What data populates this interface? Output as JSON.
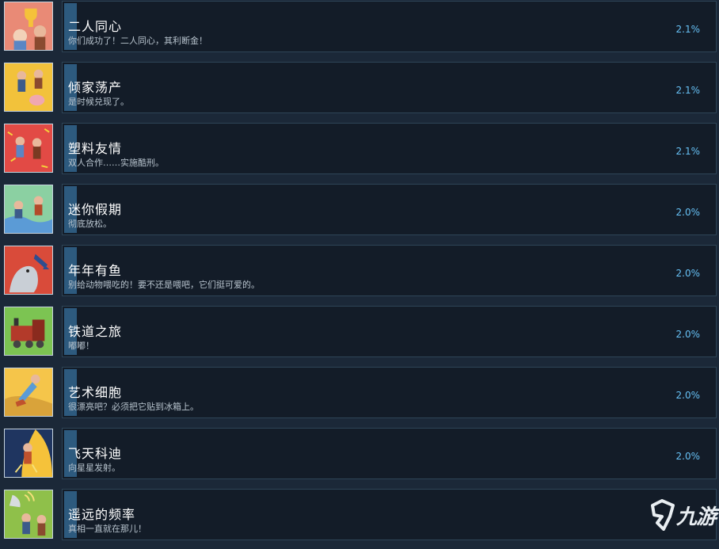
{
  "achievements": [
    {
      "id": "a1",
      "name": "二人同心",
      "desc": "你们成功了！二人同心，其利断金！",
      "percent": "2.1%",
      "art": "trophy-icon",
      "bg": "#e98a76"
    },
    {
      "id": "a2",
      "name": "倾家荡产",
      "desc": "是时候兑现了。",
      "percent": "2.1%",
      "art": "piggy-bank-icon",
      "bg": "#f2c23b"
    },
    {
      "id": "a3",
      "name": "塑料友情",
      "desc": "双人合作……实施酷刑。",
      "percent": "2.1%",
      "art": "fight-icon",
      "bg": "#e24a45"
    },
    {
      "id": "a4",
      "name": "迷你假期",
      "desc": "彻底放松。",
      "percent": "2.0%",
      "art": "vacation-icon",
      "bg": "#6ab58c"
    },
    {
      "id": "a5",
      "name": "年年有鱼",
      "desc": "别给动物喂吃的！要不还是喂吧，它们挺可爱的。",
      "percent": "2.0%",
      "art": "seal-fish-icon",
      "bg": "#d94b3a"
    },
    {
      "id": "a6",
      "name": "铁道之旅",
      "desc": "嘟嘟！",
      "percent": "2.0%",
      "art": "train-icon",
      "bg": "#7cc452"
    },
    {
      "id": "a7",
      "name": "艺术细胞",
      "desc": "很漂亮吧？必须把它贴到冰箱上。",
      "percent": "2.0%",
      "art": "painting-icon",
      "bg": "#f5c54a"
    },
    {
      "id": "a8",
      "name": "飞天科迪",
      "desc": "向星星发射。",
      "percent": "2.0%",
      "art": "rocket-launch-icon",
      "bg": "#1f3560"
    },
    {
      "id": "a9",
      "name": "遥远的频率",
      "desc": "真相一直就在那儿！",
      "percent": "",
      "art": "radio-dish-icon",
      "bg": "#8fc04a"
    }
  ],
  "watermark": {
    "brand": "九游"
  }
}
